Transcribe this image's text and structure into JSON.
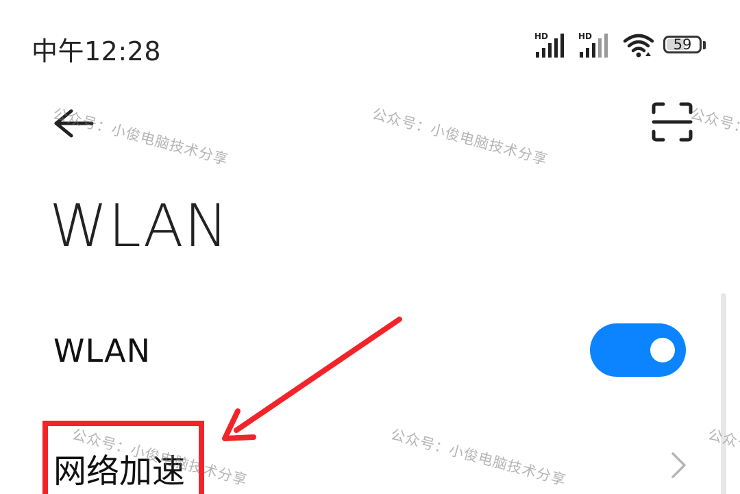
{
  "status_bar": {
    "time": "中午12:28",
    "signal1_label": "HD",
    "signal2_label": "HD",
    "wifi_icon": "wifi-icon",
    "battery_level": "59"
  },
  "header": {
    "back_icon": "back-arrow-icon",
    "scan_icon": "scan-icon"
  },
  "page": {
    "title": "WLAN"
  },
  "rows": {
    "wlan": {
      "label": "WLAN",
      "toggle_on": true,
      "accent": "#0d84ff"
    },
    "network_acceleration": {
      "label": "网络加速",
      "chevron_icon": "chevron-right-icon"
    }
  },
  "annotation": {
    "color": "#f2242a"
  },
  "watermark": {
    "text": "公众号：小俊电脑技术分享"
  }
}
